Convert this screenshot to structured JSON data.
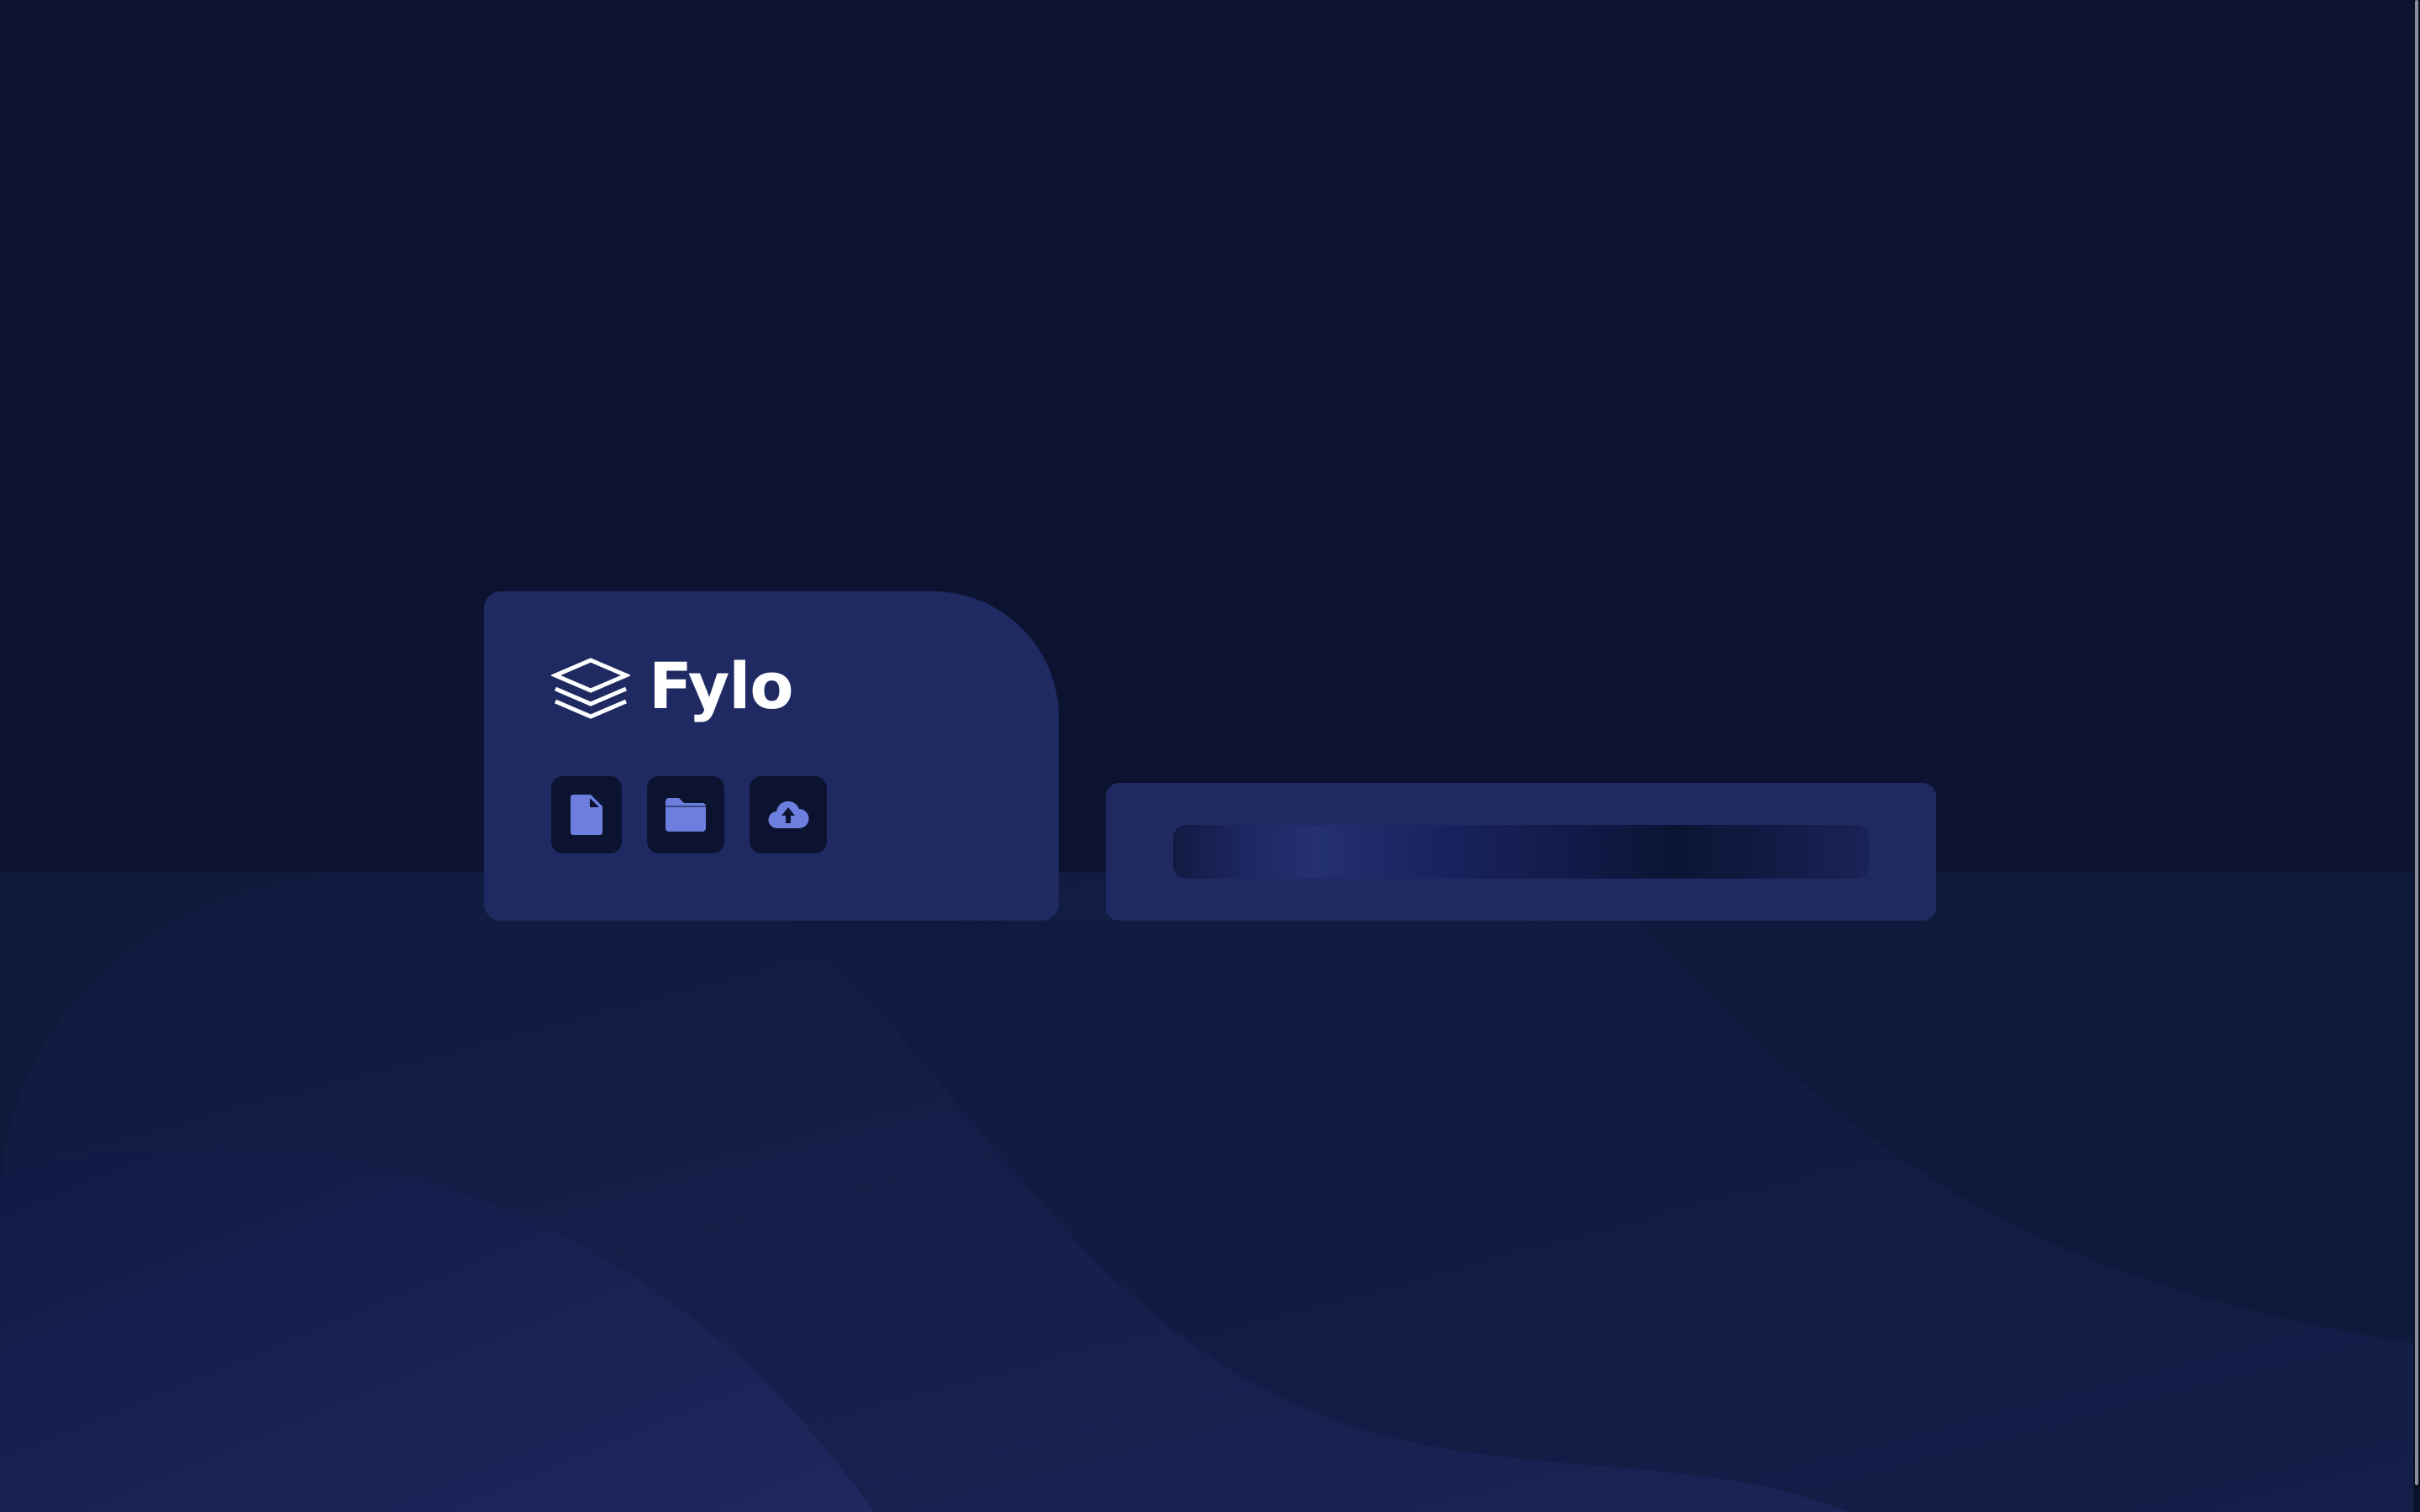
{
  "brand": {
    "name": "Fylo",
    "logo_icon": "stacked-layers-icon"
  },
  "tools": [
    {
      "name": "file",
      "icon": "file-icon"
    },
    {
      "name": "folder",
      "icon": "folder-icon"
    },
    {
      "name": "upload",
      "icon": "cloud-upload-icon"
    }
  ],
  "storage": {
    "progress_fraction": 1.0
  },
  "colors": {
    "background": "#0c1330",
    "card": "#1f2a63",
    "icon_accent": "#6d7fde",
    "text": "#ffffff"
  }
}
